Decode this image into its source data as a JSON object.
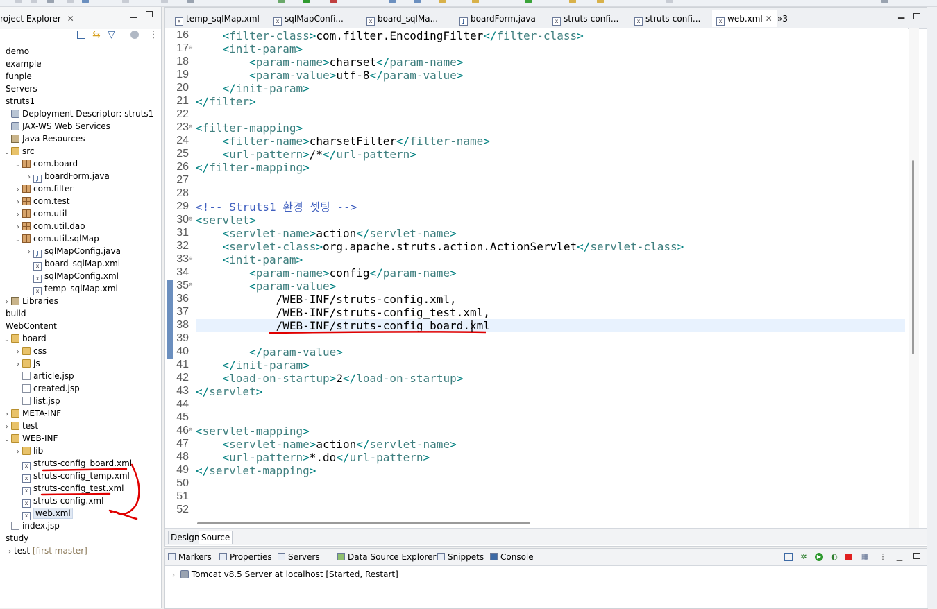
{
  "explorer": {
    "title": "roject Explorer",
    "items": [
      {
        "label": "demo"
      },
      {
        "label": "example"
      },
      {
        "label": "funple"
      },
      {
        "label": "Servers"
      },
      {
        "label": "struts1"
      },
      {
        "label": "Deployment Descriptor: struts1"
      },
      {
        "label": "JAX-WS Web Services"
      },
      {
        "label": "Java Resources"
      },
      {
        "label": "src"
      },
      {
        "label": "com.board"
      },
      {
        "label": "boardForm.java"
      },
      {
        "label": "com.filter"
      },
      {
        "label": "com.test"
      },
      {
        "label": "com.util"
      },
      {
        "label": "com.util.dao"
      },
      {
        "label": "com.util.sqlMap"
      },
      {
        "label": "sqlMapConfig.java"
      },
      {
        "label": "board_sqlMap.xml"
      },
      {
        "label": "sqlMapConfig.xml"
      },
      {
        "label": "temp_sqlMap.xml"
      },
      {
        "label": "Libraries"
      },
      {
        "label": "build"
      },
      {
        "label": "WebContent"
      },
      {
        "label": "board"
      },
      {
        "label": "css"
      },
      {
        "label": "js"
      },
      {
        "label": "article.jsp"
      },
      {
        "label": "created.jsp"
      },
      {
        "label": "list.jsp"
      },
      {
        "label": "META-INF"
      },
      {
        "label": "test"
      },
      {
        "label": "WEB-INF"
      },
      {
        "label": "lib"
      },
      {
        "label": "struts-config_board.xml"
      },
      {
        "label": "struts-config_temp.xml"
      },
      {
        "label": "struts-config_test.xml"
      },
      {
        "label": "struts-config.xml"
      },
      {
        "label": "web.xml"
      },
      {
        "label": "index.jsp"
      },
      {
        "label": "study"
      },
      {
        "label": "test",
        "suffix": "[first master]"
      }
    ]
  },
  "editor": {
    "tabs": [
      {
        "label": "temp_sqlMap.xml"
      },
      {
        "label": "sqlMapConfi..."
      },
      {
        "label": "board_sqlMa..."
      },
      {
        "label": "boardForm.java"
      },
      {
        "label": "struts-confi..."
      },
      {
        "label": "struts-confi..."
      },
      {
        "label": "web.xml",
        "active": true
      }
    ],
    "overflow_label": "»3",
    "line_numbers": [
      "16",
      "17",
      "18",
      "19",
      "20",
      "21",
      "22",
      "23",
      "24",
      "25",
      "26",
      "27",
      "28",
      "29",
      "30",
      "31",
      "32",
      "33",
      "34",
      "35",
      "36",
      "37",
      "38",
      "39",
      "40",
      "41",
      "42",
      "43",
      "44",
      "45",
      "46",
      "47",
      "48",
      "49",
      "50",
      "51",
      "52"
    ],
    "lines": [
      "    <filter-class>com.filter.EncodingFilter</filter-class>",
      "    <init-param>",
      "        <param-name>charset</param-name>",
      "        <param-value>utf-8</param-value>",
      "    </init-param>",
      "</filter>",
      "",
      "<filter-mapping>",
      "    <filter-name>charsetFilter</filter-name>",
      "    <url-pattern>/*</url-pattern>",
      "</filter-mapping>",
      "",
      "",
      "<!-- Struts1 환경 셋팅 -->",
      "<servlet>",
      "    <servlet-name>action</servlet-name>",
      "    <servlet-class>org.apache.struts.action.ActionServlet</servlet-class>",
      "    <init-param>",
      "        <param-name>config</param-name>",
      "        <param-value>",
      "            /WEB-INF/struts-config.xml,",
      "            /WEB-INF/struts-config_test.xml,",
      "            /WEB-INF/struts-config_board.xml",
      "",
      "        </param-value>",
      "    </init-param>",
      "    <load-on-startup>2</load-on-startup>",
      "</servlet>",
      "",
      "",
      "<servlet-mapping>",
      "    <servlet-name>action</servlet-name>",
      "    <url-pattern>*.do</url-pattern>",
      "</servlet-mapping>",
      "",
      "",
      ""
    ],
    "design_tab": "Design",
    "source_tab": "Source"
  },
  "bottom_panel": {
    "tabs": [
      "Markers",
      "Properties",
      "Servers",
      "Data Source Explorer",
      "Snippets",
      "Console"
    ],
    "server_row": "Tomcat v8.5 Server at localhost  [Started, Restart]"
  },
  "colors": {
    "annotation": "#e00000",
    "tag": "#3f7f7f",
    "comment": "#3f5fbf",
    "current_line": "#e8f2fe"
  }
}
